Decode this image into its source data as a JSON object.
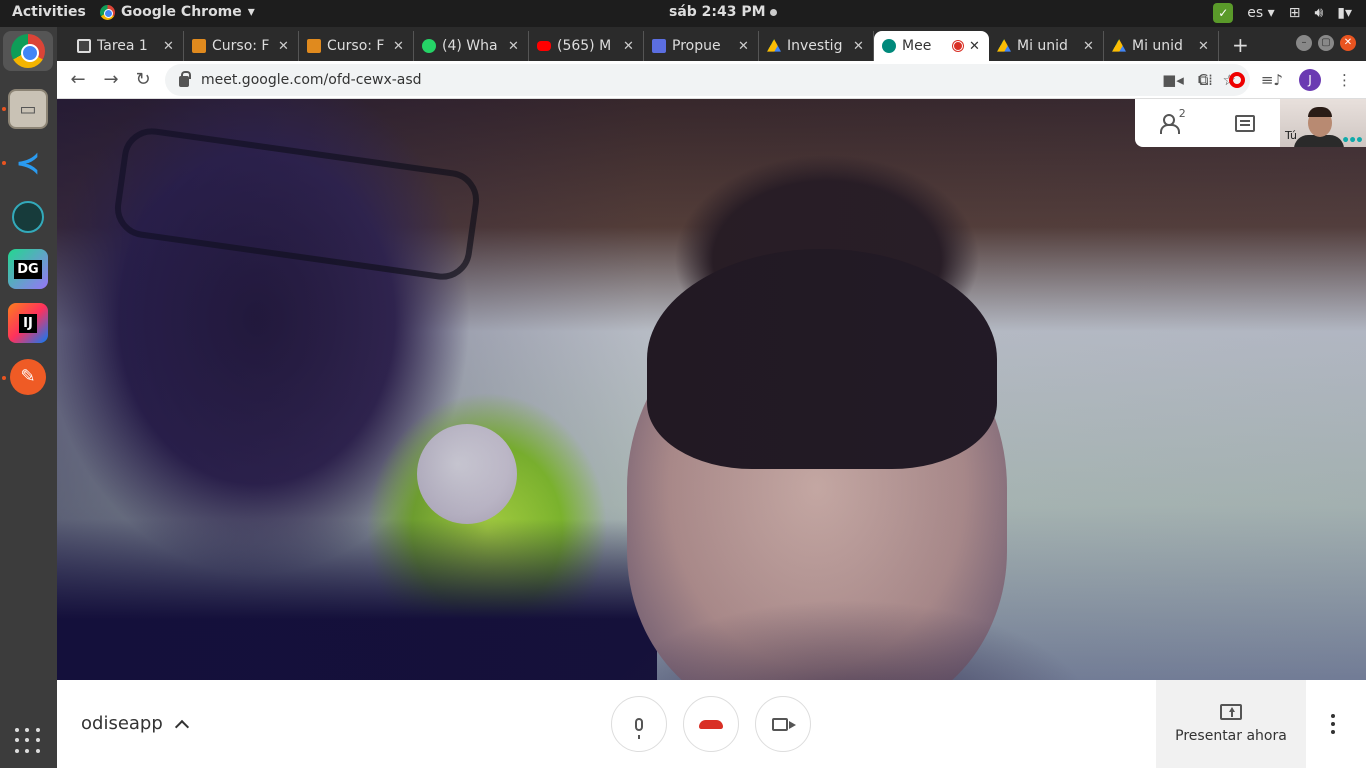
{
  "topbar": {
    "activities": "Activities",
    "app_name": "Google Chrome",
    "clock": "sáb  2:43 PM",
    "language": "es"
  },
  "dock": {
    "items": [
      "chrome-icon",
      "files-icon",
      "vscode-icon",
      "gitkraken-icon",
      "datagrip-icon",
      "intellij-icon",
      "postman-icon"
    ],
    "datagrip_label": "DG",
    "intellij_label": "IJ"
  },
  "tabs": [
    {
      "title": "Tarea 1",
      "favicon_color": "#444444"
    },
    {
      "title": "Curso: F",
      "favicon_color": "#e08a1e"
    },
    {
      "title": "Curso: F",
      "favicon_color": "#e08a1e"
    },
    {
      "title": "(4) Wha",
      "favicon_color": "#25d366"
    },
    {
      "title": "(565) M",
      "favicon_color": "#ff0000"
    },
    {
      "title": "Propue",
      "favicon_color": "#5b6ee1"
    },
    {
      "title": "Investig",
      "favicon_color": "#fbbc04"
    },
    {
      "title": "Mee",
      "favicon_color": "#00897b",
      "active": true
    },
    {
      "title": "Mi unid",
      "favicon_color": "#fbbc04"
    },
    {
      "title": "Mi unid",
      "favicon_color": "#fbbc04"
    }
  ],
  "toolbar": {
    "url": "meet.google.com/ofd-cewx-asd",
    "profile_initial": "J"
  },
  "meet": {
    "participants_count": "2",
    "self_label": "Tú",
    "meeting_name": "odiseapp",
    "present_label": "Presentar ahora"
  },
  "colors": {
    "hangup": "#d93025",
    "accent": "#00897b"
  }
}
